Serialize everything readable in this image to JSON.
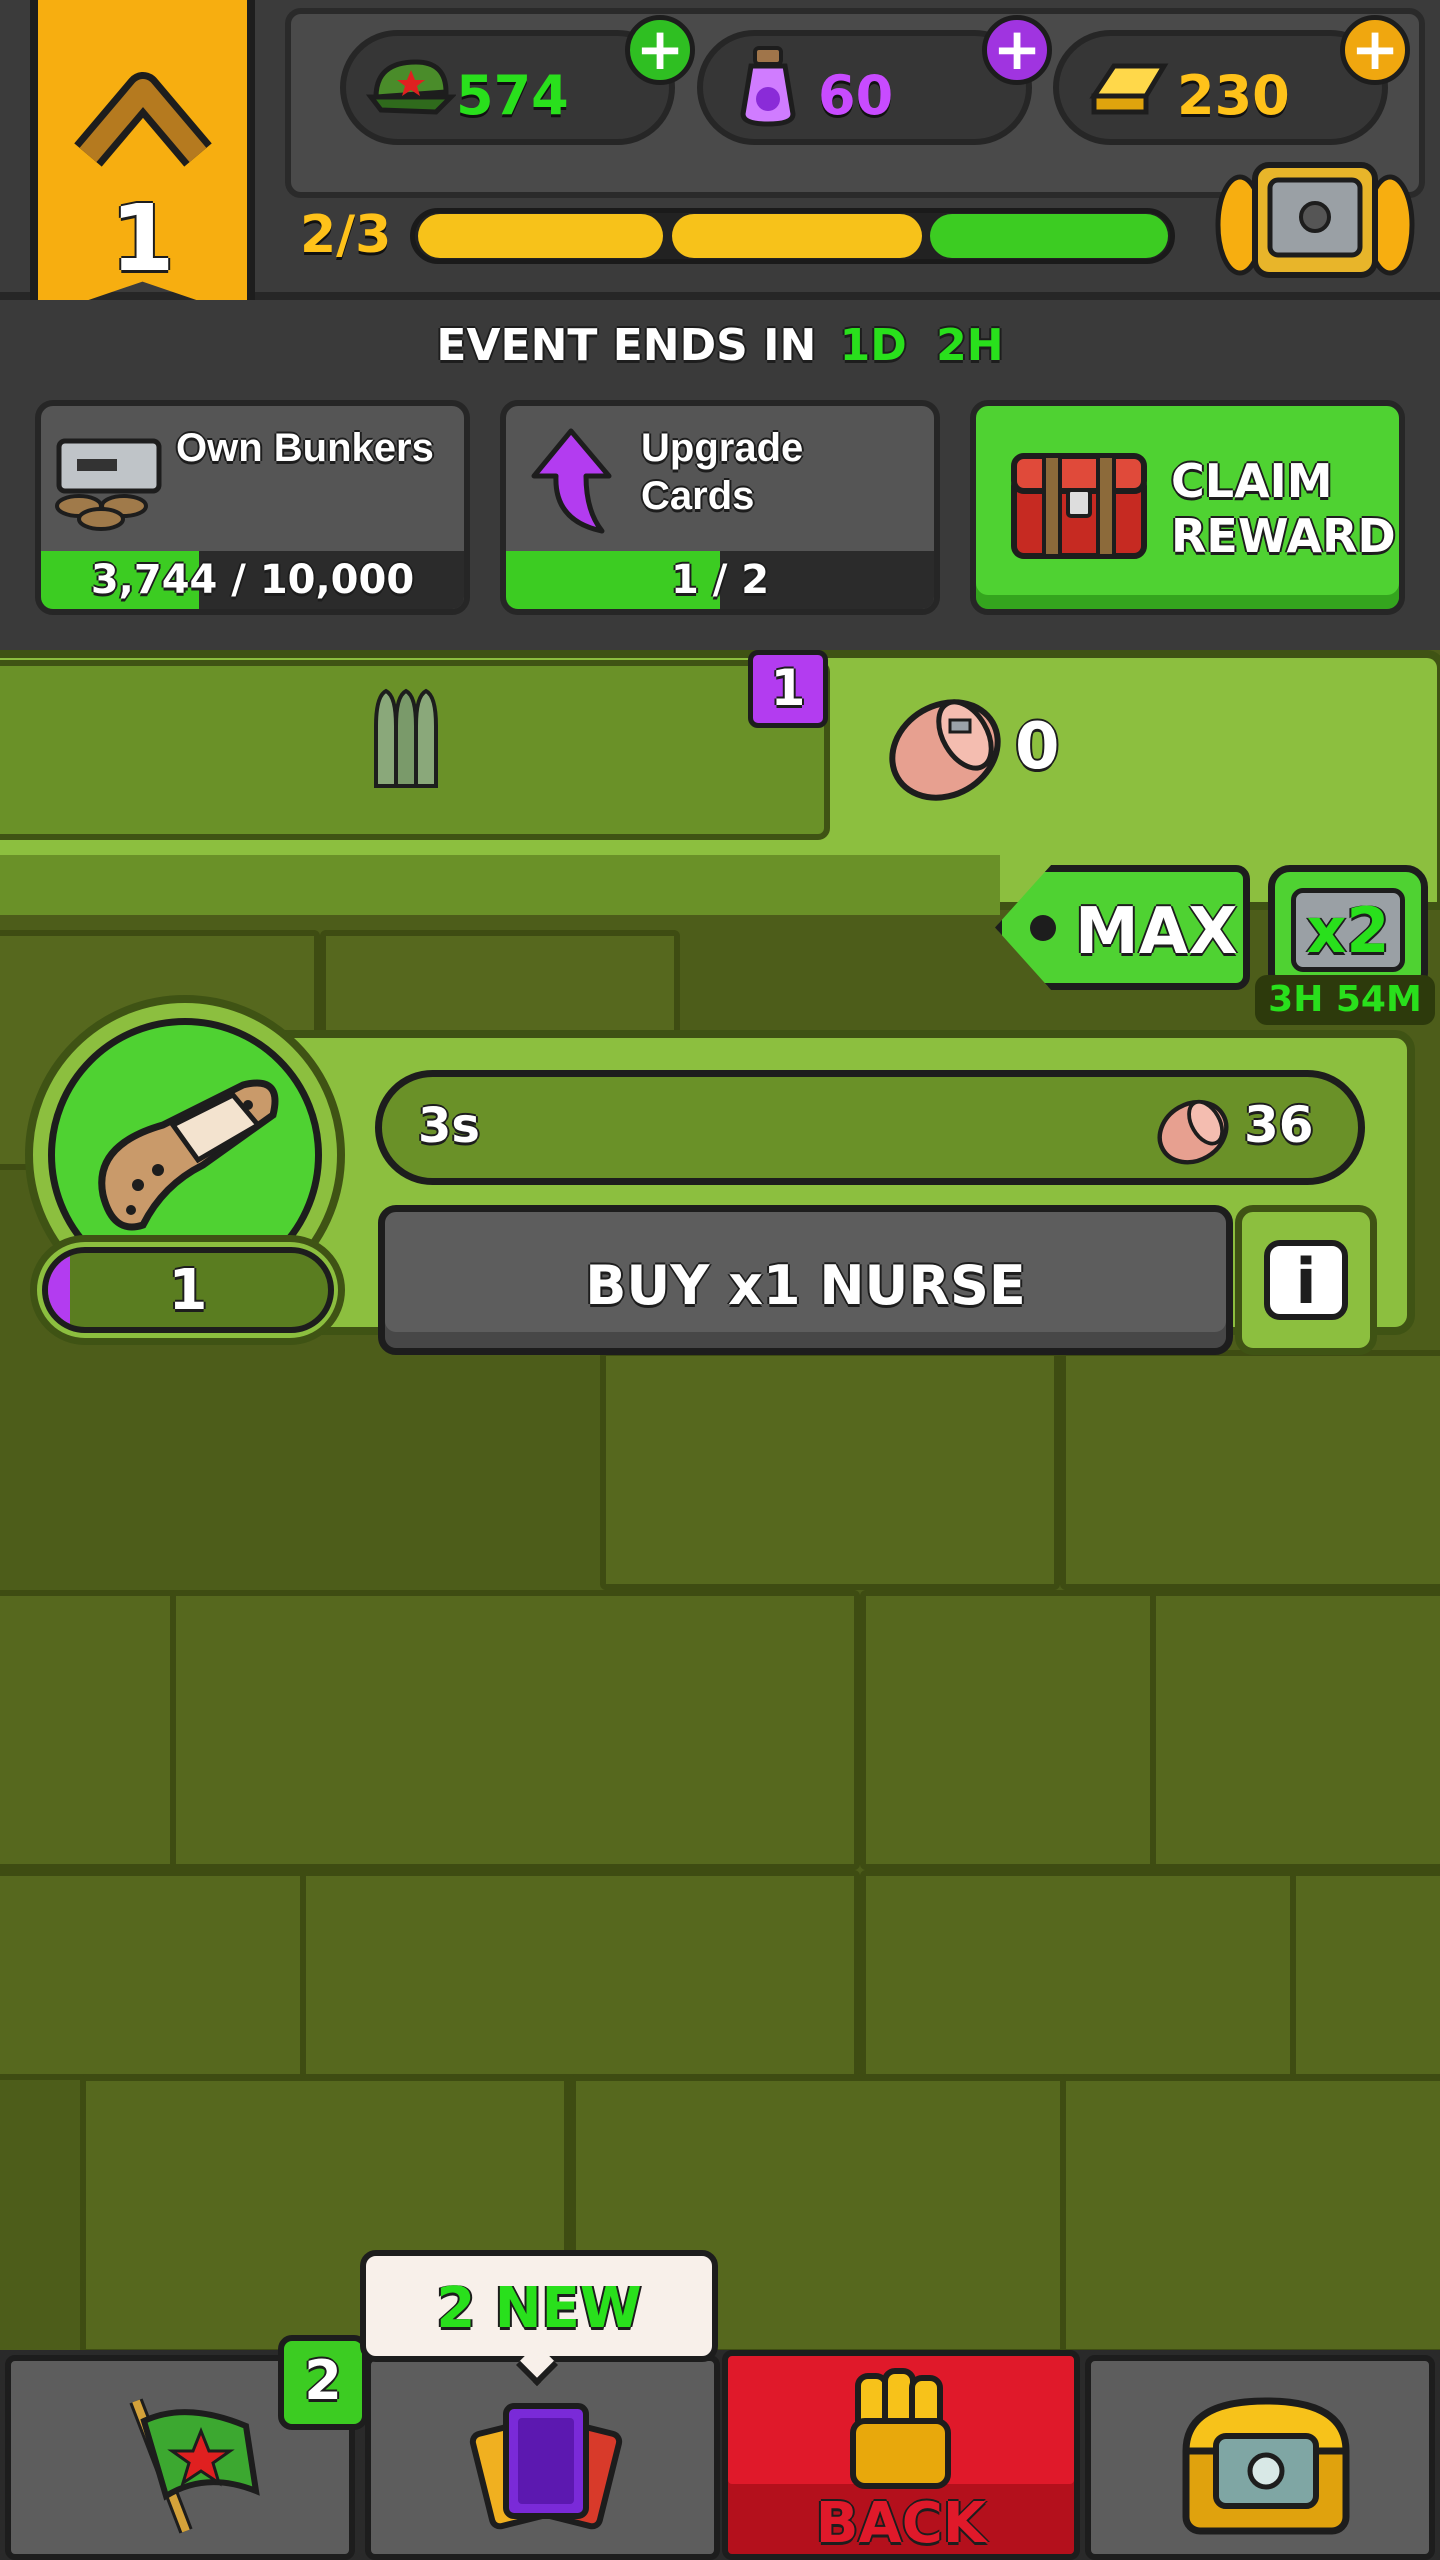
{
  "header": {
    "rank_number": "1",
    "progress_text": "2/3",
    "currencies": [
      {
        "name": "cash",
        "icon": "army-cap-icon",
        "value": "574",
        "color": "#29e01c"
      },
      {
        "name": "potion",
        "icon": "potion-icon",
        "value": "60",
        "color": "#c84bff"
      },
      {
        "name": "gold",
        "icon": "gold-bar-icon",
        "value": "230",
        "color": "#ffc21a"
      }
    ]
  },
  "event": {
    "prefix": "EVENT ENDS IN",
    "days": "1D",
    "hours": "2H",
    "tasks": [
      {
        "label": "Own Bunkers",
        "progress_text": "3,744 / 10,000",
        "progress": 0.3744
      },
      {
        "label": "Upgrade\nCards",
        "progress_text": "1 / 2",
        "progress": 0.5
      }
    ],
    "claim_label": "CLAIM\nREWARD"
  },
  "resources_panel": {
    "ammo_badge": "1",
    "bandage_count": "0"
  },
  "boost": {
    "max_label": "MAX",
    "multiplier": "x2",
    "timer": "3H 54M"
  },
  "unit": {
    "level": "1",
    "level_progress": 0.08,
    "time": "3s",
    "yield": "36",
    "buy_label": "BUY x1 NURSE",
    "info_label": "i"
  },
  "bottom_nav": {
    "tooltip": "2 NEW",
    "flag_badge": "2",
    "back_label": "BACK"
  },
  "colors": {
    "accent_green": "#29e01c",
    "purple": "#b33cf0",
    "gold": "#f7ae10",
    "back_red": "#e0192a"
  }
}
